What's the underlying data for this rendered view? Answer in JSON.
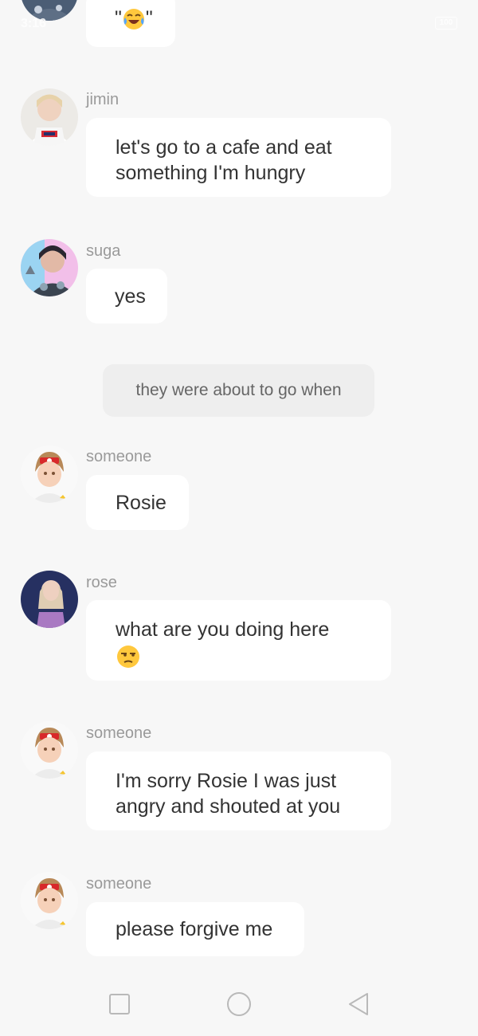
{
  "status_bar": {
    "time": "3:16",
    "battery": "100"
  },
  "messages": [
    {
      "sender": "",
      "avatar": "bts-member-avatar",
      "text": "\"",
      "emoji": "joy-emoji",
      "suffix": "\""
    },
    {
      "sender": "jimin",
      "avatar": "jimin-avatar",
      "lines": [
        "let's go to a cafe and eat",
        "something I'm hungry"
      ]
    },
    {
      "sender": "suga",
      "avatar": "suga-avatar",
      "lines": [
        "yes"
      ]
    },
    {
      "sender": "someone",
      "avatar": "anime-boy-avatar",
      "lines": [
        "Rosie"
      ]
    },
    {
      "sender": "rose",
      "avatar": "rose-avatar",
      "lines": [
        "what are you doing here"
      ],
      "emoji": "unamused-emoji"
    },
    {
      "sender": "someone",
      "avatar": "anime-boy-avatar",
      "lines": [
        "I'm sorry Rosie I was just",
        "angry and shouted at you"
      ]
    },
    {
      "sender": "someone",
      "avatar": "anime-boy-avatar",
      "lines": [
        "please forgive me"
      ]
    }
  ],
  "narration": "they were about to go when",
  "nav": {
    "recent_icon": "square-icon",
    "home_icon": "circle-icon",
    "back_icon": "triangle-back-icon"
  },
  "colors": {
    "background": "#f7f7f7",
    "bubble": "#ffffff",
    "narration_bubble": "#eeeeee",
    "sender_text": "#9a9a9a",
    "message_text": "#333333"
  }
}
